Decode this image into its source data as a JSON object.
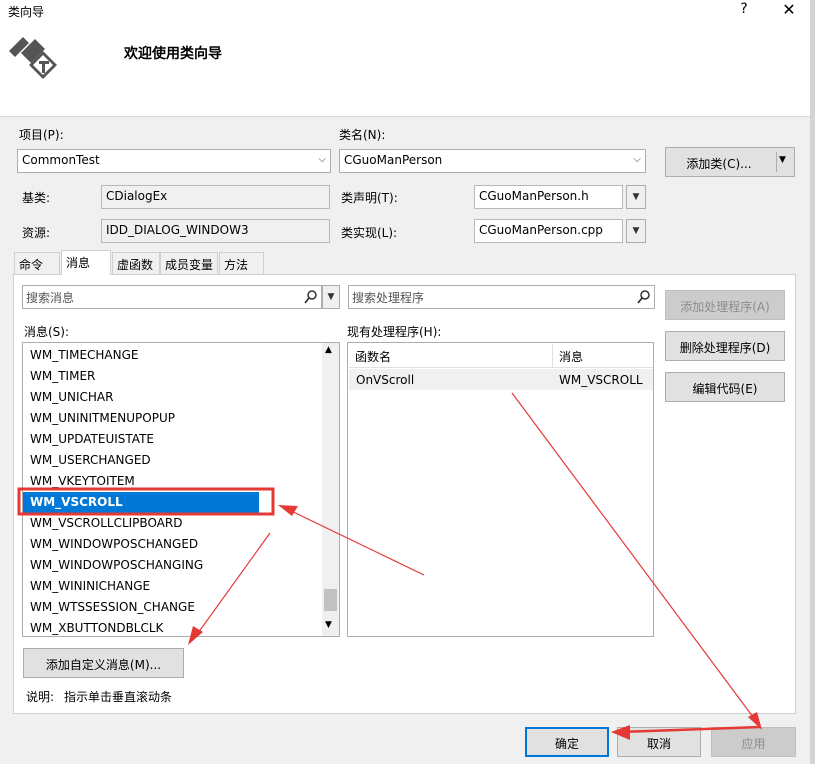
{
  "window": {
    "title": "类向导",
    "help": "?",
    "close": "✕"
  },
  "header": {
    "title": "欢迎使用类向导"
  },
  "project": {
    "label": "项目(P):",
    "value": "CommonTest"
  },
  "classname": {
    "label": "类名(N):",
    "value": "CGuoManPerson"
  },
  "add_class_button": "添加类(C)...",
  "base_class": {
    "label": "基类:",
    "value": "CDialogEx"
  },
  "resource": {
    "label": "资源:",
    "value": "IDD_DIALOG_WINDOW3"
  },
  "class_decl": {
    "label": "类声明(T):",
    "value": "CGuoManPerson.h"
  },
  "class_impl": {
    "label": "类实现(L):",
    "value": "CGuoManPerson.cpp"
  },
  "tabs": [
    "命令",
    "消息",
    "虚函数",
    "成员变量",
    "方法"
  ],
  "search_messages_placeholder": "搜索消息",
  "search_handlers_placeholder": "搜索处理程序",
  "messages_label": "消息(S):",
  "handlers_label": "现有处理程序(H):",
  "messages": [
    "WM_TIMECHANGE",
    "WM_TIMER",
    "WM_UNICHAR",
    "WM_UNINITMENUPOPUP",
    "WM_UPDATEUISTATE",
    "WM_USERCHANGED",
    "WM_VKEYTOITEM",
    "WM_VSCROLL",
    "WM_VSCROLLCLIPBOARD",
    "WM_WINDOWPOSCHANGED",
    "WM_WINDOWPOSCHANGING",
    "WM_WININICHANGE",
    "WM_WTSSESSION_CHANGE",
    "WM_XBUTTONDBLCLK"
  ],
  "selected_message": "WM_VSCROLL",
  "handler_columns": [
    "函数名",
    "消息"
  ],
  "handlers": [
    {
      "function": "OnVScroll",
      "message": "WM_VSCROLL"
    }
  ],
  "side_buttons": {
    "add_handler": "添加处理程序(A)",
    "delete_handler": "删除处理程序(D)",
    "edit_code": "编辑代码(E)"
  },
  "add_custom_message_button": "添加自定义消息(M)...",
  "description_label": "说明:",
  "description_text": "指示单击垂直滚动条",
  "footer": {
    "ok": "确定",
    "cancel": "取消",
    "apply": "应用"
  },
  "colors": {
    "selection": "#0078d7",
    "annotation": "#e53935"
  }
}
